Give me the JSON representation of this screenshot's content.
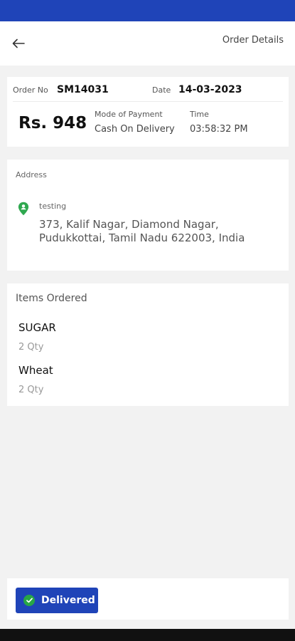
{
  "app_bar": {
    "title": "Order Details",
    "back_icon": "arrow-left-icon"
  },
  "order": {
    "order_no_label": "Order No",
    "order_no": "SM14031",
    "date_label": "Date",
    "date": "14-03-2023",
    "amount": "Rs. 948",
    "mode_of_payment_label": "Mode of Payment",
    "mode_of_payment": "Cash On Delivery",
    "time_label": "Time",
    "time": "03:58:32 PM"
  },
  "address": {
    "section_label": "Address",
    "icon": "location-pin-icon",
    "name": "testing",
    "lines": [
      "373, Kalif Nagar, Diamond Nagar,",
      "Pudukkottai, Tamil Nadu 622003, India"
    ]
  },
  "items": {
    "title": "Items Ordered",
    "list": [
      {
        "name": "SUGAR",
        "qty": "2 Qty"
      },
      {
        "name": "Wheat",
        "qty": "2 Qty"
      }
    ]
  },
  "status": {
    "label": "Delivered",
    "icon": "check-circle-icon"
  },
  "colors": {
    "primary": "#1f44b8",
    "success": "#28a745",
    "background": "#f2f2f2"
  }
}
